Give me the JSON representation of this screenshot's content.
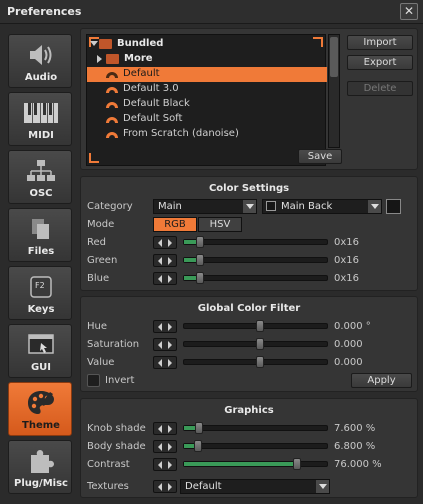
{
  "window": {
    "title": "Preferences",
    "close_glyph": "✕"
  },
  "sidebar": {
    "items": [
      {
        "label": "Audio",
        "icon": "speaker-icon",
        "active": false
      },
      {
        "label": "MIDI",
        "icon": "piano-keys-icon",
        "active": false
      },
      {
        "label": "OSC",
        "icon": "network-icon",
        "active": false
      },
      {
        "label": "Files",
        "icon": "files-icon",
        "active": false
      },
      {
        "label": "Keys",
        "icon": "keyboard-key-icon",
        "active": false
      },
      {
        "label": "GUI",
        "icon": "window-icon",
        "active": false
      },
      {
        "label": "Theme",
        "icon": "palette-icon",
        "active": true
      },
      {
        "label": "Plug/Misc",
        "icon": "puzzle-piece-icon",
        "active": false
      }
    ]
  },
  "themes": {
    "root": "Bundled",
    "folder": "More",
    "items": [
      "Default",
      "Default 3.0",
      "Default Black",
      "Default Soft",
      "From Scratch (danoise)"
    ],
    "selected": "Default",
    "buttons": {
      "import": "Import",
      "export": "Export",
      "delete": "Delete",
      "save": "Save"
    }
  },
  "color_settings": {
    "title": "Color Settings",
    "category_label": "Category",
    "category_value": "Main",
    "target_value": "Main Back",
    "mode_label": "Mode",
    "mode_rgb": "RGB",
    "mode_hsv": "HSV",
    "mode_selected": "RGB",
    "rows": [
      {
        "label": "Red",
        "value": "0x16",
        "level": 0.086
      },
      {
        "label": "Green",
        "value": "0x16",
        "level": 0.086
      },
      {
        "label": "Blue",
        "value": "0x16",
        "level": 0.086
      }
    ]
  },
  "global_filter": {
    "title": "Global Color Filter",
    "rows": [
      {
        "label": "Hue",
        "value": "0.000 °",
        "level": 0.5
      },
      {
        "label": "Saturation",
        "value": "0.000",
        "level": 0.5
      },
      {
        "label": "Value",
        "value": "0.000",
        "level": 0.5
      }
    ],
    "invert_label": "Invert",
    "apply_label": "Apply"
  },
  "graphics": {
    "title": "Graphics",
    "rows": [
      {
        "label": "Knob shade",
        "value": "7.600 %",
        "level": 0.076
      },
      {
        "label": "Body shade",
        "value": "6.800 %",
        "level": 0.068
      },
      {
        "label": "Contrast",
        "value": "76.000 %",
        "level": 0.76
      }
    ],
    "textures_label": "Textures",
    "textures_value": "Default"
  },
  "colors": {
    "accent": "#f07a38",
    "slider_fill": "#3a9a58"
  }
}
